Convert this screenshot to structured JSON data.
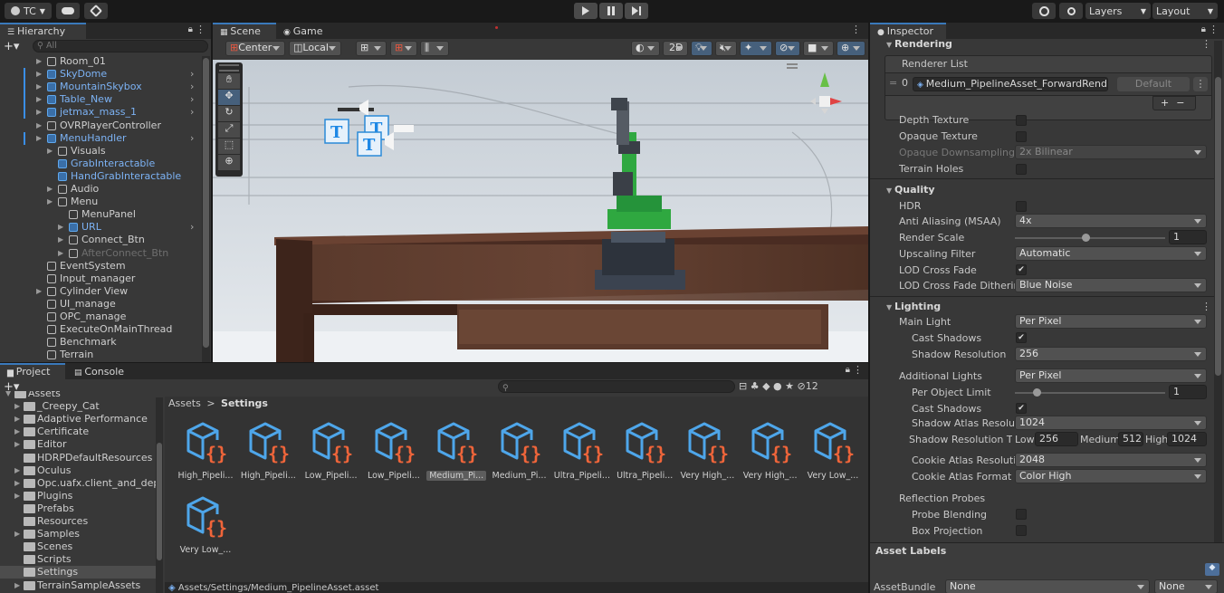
{
  "toolbar": {
    "account": "TC",
    "layers": "Layers",
    "layout": "Layout"
  },
  "hierarchy": {
    "tab": "Hierarchy",
    "search_placeholder": "All",
    "items": [
      {
        "label": "Room_01",
        "indent": 0,
        "blue": false,
        "arrow": true,
        "more": false
      },
      {
        "label": "SkyDome",
        "indent": 0,
        "blue": true,
        "arrow": true,
        "more": true
      },
      {
        "label": "MountainSkybox",
        "indent": 0,
        "blue": true,
        "arrow": true,
        "more": true
      },
      {
        "label": "Table_New",
        "indent": 0,
        "blue": true,
        "arrow": true,
        "more": true
      },
      {
        "label": "jetmax_mass_1",
        "indent": 0,
        "blue": true,
        "arrow": true,
        "more": true
      },
      {
        "label": "OVRPlayerController",
        "indent": 0,
        "blue": false,
        "arrow": true,
        "more": false
      },
      {
        "label": "MenuHandler",
        "indent": 0,
        "blue": true,
        "arrow": true,
        "more": true
      },
      {
        "label": "Visuals",
        "indent": 1,
        "blue": false,
        "arrow": true,
        "more": false
      },
      {
        "label": "GrabInteractable",
        "indent": 1,
        "blue": true,
        "arrow": false,
        "more": false
      },
      {
        "label": "HandGrabInteractable",
        "indent": 1,
        "blue": true,
        "arrow": false,
        "more": false
      },
      {
        "label": "Audio",
        "indent": 1,
        "blue": false,
        "arrow": true,
        "more": false
      },
      {
        "label": "Menu",
        "indent": 1,
        "blue": false,
        "arrow": true,
        "more": false
      },
      {
        "label": "MenuPanel",
        "indent": 2,
        "blue": false,
        "arrow": false,
        "more": false
      },
      {
        "label": "URL",
        "indent": 2,
        "blue": true,
        "arrow": true,
        "more": true
      },
      {
        "label": "Connect_Btn",
        "indent": 2,
        "blue": false,
        "arrow": true,
        "more": false
      },
      {
        "label": "AfterConnect_Btn",
        "indent": 2,
        "blue": false,
        "arrow": true,
        "more": false,
        "dim": true
      },
      {
        "label": "EventSystem",
        "indent": 0,
        "blue": false,
        "arrow": false,
        "more": false
      },
      {
        "label": "Input_manager",
        "indent": 0,
        "blue": false,
        "arrow": false,
        "more": false
      },
      {
        "label": "Cylinder View",
        "indent": 0,
        "blue": false,
        "arrow": true,
        "more": false
      },
      {
        "label": "UI_manage",
        "indent": 0,
        "blue": false,
        "arrow": false,
        "more": false
      },
      {
        "label": "OPC_manage",
        "indent": 0,
        "blue": false,
        "arrow": false,
        "more": false
      },
      {
        "label": "ExecuteOnMainThread",
        "indent": 0,
        "blue": false,
        "arrow": false,
        "more": false
      },
      {
        "label": "Benchmark",
        "indent": 0,
        "blue": false,
        "arrow": false,
        "more": false
      },
      {
        "label": "Terrain",
        "indent": 0,
        "blue": false,
        "arrow": false,
        "more": false
      }
    ]
  },
  "scene": {
    "tab_scene": "Scene",
    "tab_game": "Game",
    "pivot": "Center",
    "space": "Local",
    "mode_2d": "2D"
  },
  "project": {
    "tab_project": "Project",
    "tab_console": "Console",
    "breadcrumb_root": "Assets",
    "breadcrumb_sep": ">",
    "breadcrumb_current": "Settings",
    "hidden_count": "12",
    "status_path": "Assets/Settings/Medium_PipelineAsset.asset",
    "tree": [
      {
        "label": "Assets",
        "arrow": true
      },
      {
        "label": "_Creepy_Cat",
        "arrow": true
      },
      {
        "label": "Adaptive Performance",
        "arrow": true
      },
      {
        "label": "Certificate",
        "arrow": true
      },
      {
        "label": "Editor",
        "arrow": true
      },
      {
        "label": "HDRPDefaultResources",
        "arrow": false
      },
      {
        "label": "Oculus",
        "arrow": true
      },
      {
        "label": "Opc.uafx.client_and_depe",
        "arrow": true
      },
      {
        "label": "Plugins",
        "arrow": true
      },
      {
        "label": "Prefabs",
        "arrow": false
      },
      {
        "label": "Resources",
        "arrow": false
      },
      {
        "label": "Samples",
        "arrow": true
      },
      {
        "label": "Scenes",
        "arrow": false
      },
      {
        "label": "Scripts",
        "arrow": false
      },
      {
        "label": "Settings",
        "arrow": false,
        "selected": true
      },
      {
        "label": "TerrainSampleAssets",
        "arrow": true
      }
    ],
    "assets": [
      "High_Pipeli...",
      "High_Pipeli...",
      "Low_Pipeli...",
      "Low_Pipeli...",
      "Medium_Pi...",
      "Medium_Pi...",
      "Ultra_Pipeli...",
      "Ultra_Pipeli...",
      "Very High_...",
      "Very High_...",
      "Very Low_...",
      "Very Low_..."
    ],
    "selected_asset": 4
  },
  "inspector": {
    "tab": "Inspector",
    "rendering": "Rendering",
    "renderer_list": "Renderer List",
    "renderer_index": "0",
    "renderer_asset": "Medium_PipelineAsset_ForwardRend",
    "renderer_default": "Default",
    "depth_texture": "Depth Texture",
    "opaque_texture": "Opaque Texture",
    "opaque_downsampling": "Opaque Downsampling",
    "opaque_downsampling_value": "2x Bilinear",
    "terrain_holes": "Terrain Holes",
    "quality": "Quality",
    "hdr": "HDR",
    "anti_aliasing": "Anti Aliasing (MSAA)",
    "anti_aliasing_value": "4x",
    "render_scale": "Render Scale",
    "render_scale_value": "1",
    "upscaling_filter": "Upscaling Filter",
    "upscaling_filter_value": "Automatic",
    "lod_cross_fade": "LOD Cross Fade",
    "lod_dithering": "LOD Cross Fade Dithering",
    "lod_dithering_value": "Blue Noise",
    "lighting": "Lighting",
    "main_light": "Main Light",
    "main_light_value": "Per Pixel",
    "cast_shadows": "Cast Shadows",
    "shadow_resolution": "Shadow Resolution",
    "shadow_resolution_value": "256",
    "additional_lights": "Additional Lights",
    "additional_lights_value": "Per Pixel",
    "per_object_limit": "Per Object Limit",
    "per_object_limit_value": "1",
    "cast_shadows_2": "Cast Shadows",
    "shadow_atlas": "Shadow Atlas Resoluti",
    "shadow_atlas_value": "1024",
    "shadow_tiers": "Shadow Resolution Tie",
    "tier_low": "Low",
    "tier_low_value": "256",
    "tier_medium": "Medium",
    "tier_medium_value": "512",
    "tier_high": "High",
    "tier_high_value": "1024",
    "cookie_atlas_res": "Cookie Atlas Resolutio",
    "cookie_atlas_res_value": "2048",
    "cookie_atlas_format": "Cookie Atlas Format",
    "cookie_atlas_format_value": "Color High",
    "reflection_probes": "Reflection Probes",
    "probe_blending": "Probe Blending",
    "box_projection": "Box Projection",
    "asset_labels": "Asset Labels",
    "asset_bundle": "AssetBundle",
    "asset_bundle_value": "None",
    "asset_bundle_variant": "None"
  }
}
